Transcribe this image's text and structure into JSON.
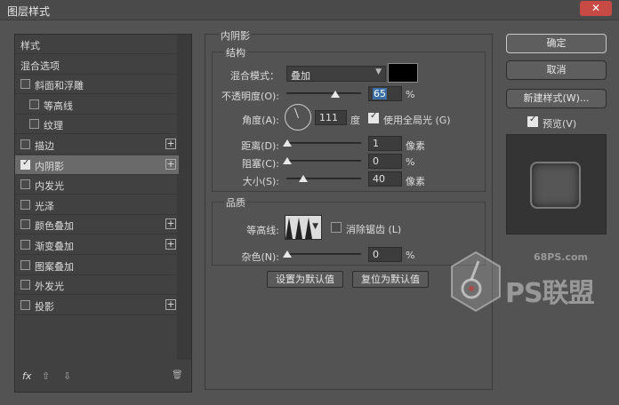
{
  "window": {
    "title": "图层样式",
    "close_glyph": "✕"
  },
  "sidebar": {
    "items": [
      {
        "label": "样式",
        "has_checkbox": false,
        "checked": false,
        "indent": false,
        "has_plus": false,
        "selected": false
      },
      {
        "label": "混合选项",
        "has_checkbox": false,
        "checked": false,
        "indent": false,
        "has_plus": false,
        "selected": false
      },
      {
        "label": "斜面和浮雕",
        "has_checkbox": true,
        "checked": false,
        "indent": false,
        "has_plus": false,
        "selected": false
      },
      {
        "label": "等高线",
        "has_checkbox": true,
        "checked": false,
        "indent": true,
        "has_plus": false,
        "selected": false
      },
      {
        "label": "纹理",
        "has_checkbox": true,
        "checked": false,
        "indent": true,
        "has_plus": false,
        "selected": false
      },
      {
        "label": "描边",
        "has_checkbox": true,
        "checked": false,
        "indent": false,
        "has_plus": true,
        "selected": false
      },
      {
        "label": "内阴影",
        "has_checkbox": true,
        "checked": true,
        "indent": false,
        "has_plus": true,
        "selected": true
      },
      {
        "label": "内发光",
        "has_checkbox": true,
        "checked": false,
        "indent": false,
        "has_plus": false,
        "selected": false
      },
      {
        "label": "光泽",
        "has_checkbox": true,
        "checked": false,
        "indent": false,
        "has_plus": false,
        "selected": false
      },
      {
        "label": "颜色叠加",
        "has_checkbox": true,
        "checked": false,
        "indent": false,
        "has_plus": true,
        "selected": false
      },
      {
        "label": "渐变叠加",
        "has_checkbox": true,
        "checked": false,
        "indent": false,
        "has_plus": true,
        "selected": false
      },
      {
        "label": "图案叠加",
        "has_checkbox": true,
        "checked": false,
        "indent": false,
        "has_plus": false,
        "selected": false
      },
      {
        "label": "外发光",
        "has_checkbox": true,
        "checked": false,
        "indent": false,
        "has_plus": false,
        "selected": false
      },
      {
        "label": "投影",
        "has_checkbox": true,
        "checked": false,
        "indent": false,
        "has_plus": true,
        "selected": false
      }
    ],
    "plus_glyph": "+",
    "footer": {
      "fx_label": "fx",
      "up_glyph": "⇧",
      "down_glyph": "⇩",
      "trash_glyph": "🗑"
    }
  },
  "inner_shadow": {
    "section_title": "内阴影",
    "structure": {
      "title": "结构",
      "blend_mode_label": "混合模式：",
      "blend_mode_value": "叠加",
      "blend_color": "#000000",
      "opacity_label": "不透明度(O):",
      "opacity_value": "65",
      "opacity_unit": "%",
      "angle_label": "角度(A):",
      "angle_value": "111",
      "angle_unit": "度",
      "global_light_label": "使用全局光 (G)",
      "global_light_checked": true,
      "distance_label": "距离(D):",
      "distance_value": "1",
      "distance_unit": "像素",
      "choke_label": "阻塞(C):",
      "choke_value": "0",
      "choke_unit": "%",
      "size_label": "大小(S):",
      "size_value": "40",
      "size_unit": "像素"
    },
    "quality": {
      "title": "品质",
      "contour_label": "等高线:",
      "anti_alias_label": "消除锯齿 (L)",
      "anti_alias_checked": false,
      "noise_label": "杂色(N):",
      "noise_value": "0",
      "noise_unit": "%"
    },
    "make_default_label": "设置为默认值",
    "reset_default_label": "复位为默认值"
  },
  "actions": {
    "ok_label": "确定",
    "cancel_label": "取消",
    "new_style_label": "新建样式(W)...",
    "preview_label": "预览(V)",
    "preview_checked": true
  },
  "watermark": {
    "url": "68PS.com",
    "brand": "PS联盟"
  }
}
